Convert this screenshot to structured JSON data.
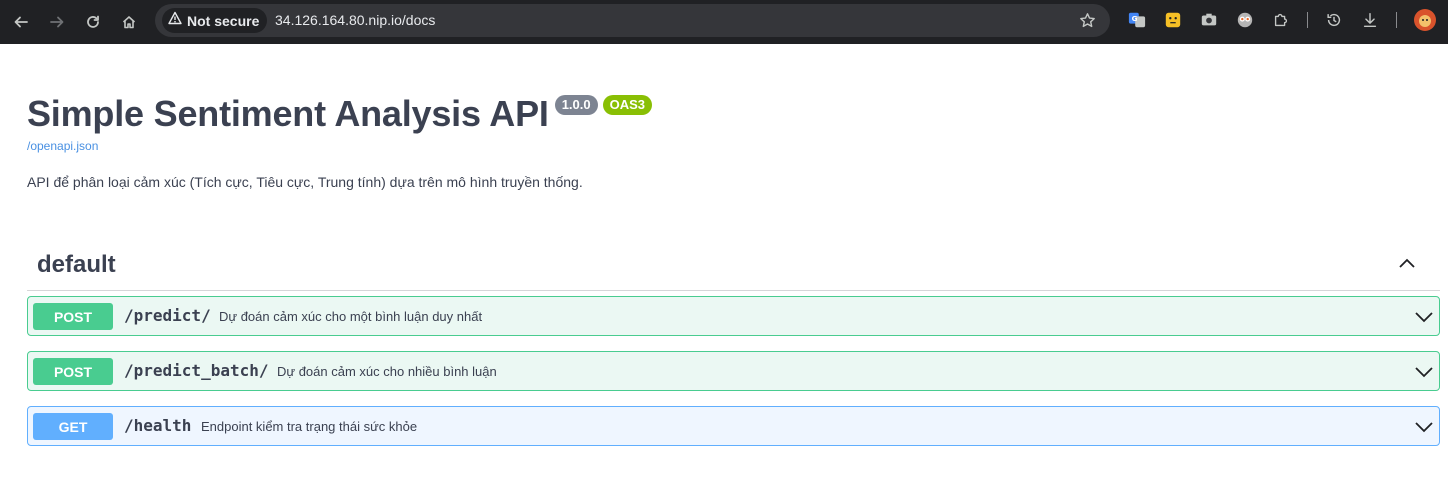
{
  "browser": {
    "security_label": "Not secure",
    "url": "34.126.164.80.nip.io/docs",
    "icons": [
      "back-icon",
      "forward-icon",
      "reload-icon",
      "home-icon",
      "warning-icon",
      "star-icon",
      "translate-extension-icon",
      "emoji-extension-icon",
      "camera-extension-icon",
      "owl-extension-icon",
      "puzzle-extension-icon",
      "history-icon",
      "download-icon",
      "profile-avatar"
    ]
  },
  "page": {
    "title": "Simple Sentiment Analysis API",
    "version": "1.0.0",
    "oas": "OAS3",
    "spec_link": "/openapi.json",
    "description": "API để phân loại cảm xúc (Tích cực, Tiêu cực, Trung tính) dựa trên mô hình truyền thống."
  },
  "section": {
    "title": "default"
  },
  "operations": [
    {
      "method": "POST",
      "path": "/predict/",
      "summary": "Dự đoán cảm xúc cho một bình luận duy nhất"
    },
    {
      "method": "POST",
      "path": "/predict_batch/",
      "summary": "Dự đoán cảm xúc cho nhiều bình luận"
    },
    {
      "method": "GET",
      "path": "/health",
      "summary": "Endpoint kiểm tra trạng thái sức khỏe"
    }
  ],
  "colors": {
    "post": "#49cc90",
    "get": "#61affe",
    "text": "#3b4151",
    "link": "#4990e2",
    "chrome": "#202124"
  }
}
